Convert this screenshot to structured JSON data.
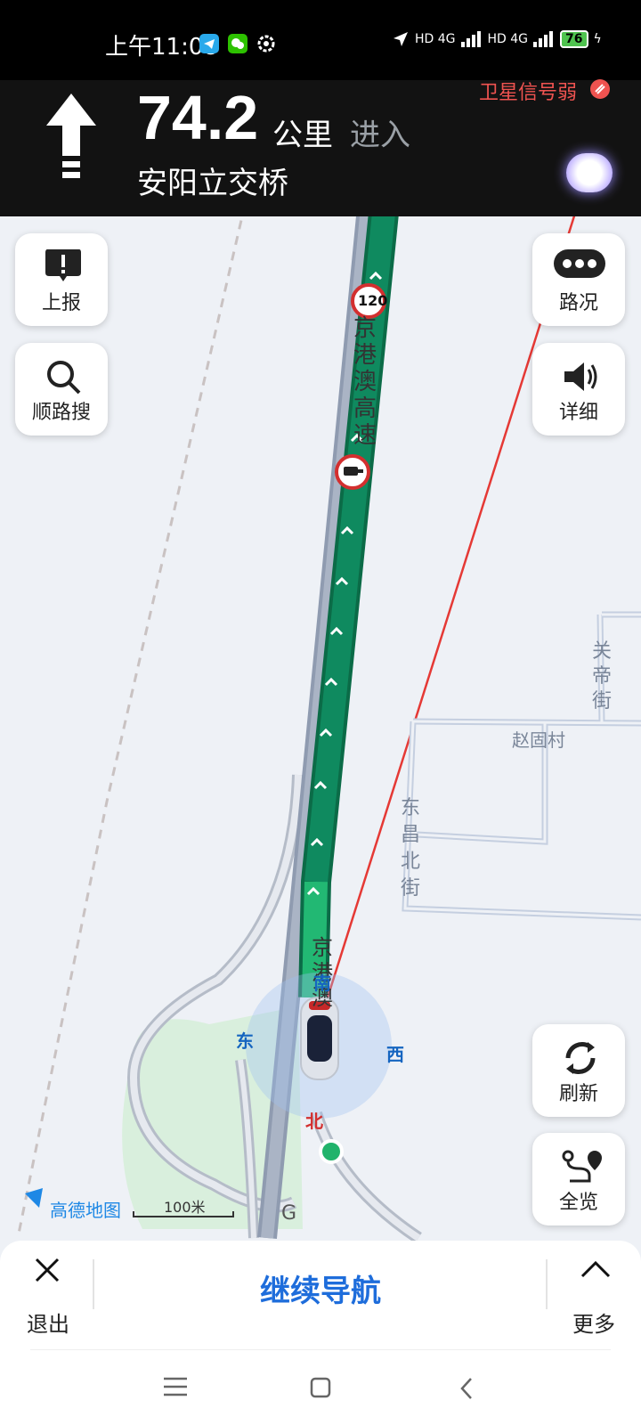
{
  "status_bar": {
    "time": "上午11:08",
    "network": "HD 4G",
    "network2": "HD 4G",
    "battery": "76"
  },
  "navigation": {
    "distance_value": "74.2",
    "distance_unit": "公里",
    "action": "进入",
    "next_road": "安阳立交桥",
    "gps_status": "卫星信号弱"
  },
  "side_buttons": {
    "report": "上报",
    "search_along": "顺路搜",
    "traffic": "路况",
    "detail": "详细",
    "refresh": "刷新",
    "overview": "全览"
  },
  "map": {
    "highway_name": "京港澳高速",
    "highway_name_short": "京港澳",
    "speed_limit": "120",
    "roads": {
      "guandi_street": "关帝街",
      "zhaogu_village": "赵固村",
      "dongchang_north_street": "东昌北街"
    },
    "compass": {
      "east": "东",
      "west": "西",
      "south": "南",
      "north": "北"
    },
    "highway_marker": "G",
    "scale": "100米",
    "brand": "高德地图"
  },
  "bottom_bar": {
    "exit": "退出",
    "continue": "继续导航",
    "more": "更多"
  },
  "colors": {
    "route_green": "#0f8a5f",
    "route_light_green": "#22b873",
    "accent_blue": "#1e6ddb",
    "warning_red": "#ef5350",
    "park_green": "#d9efdd"
  }
}
